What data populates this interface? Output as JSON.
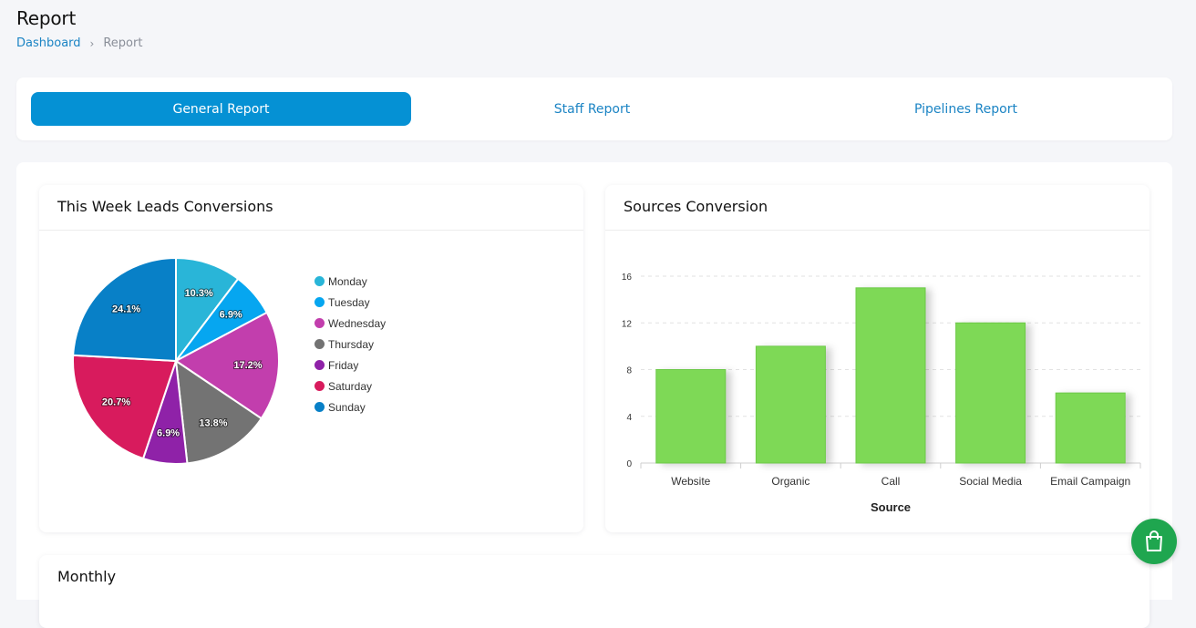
{
  "header": {
    "title": "Report",
    "breadcrumb": {
      "home": "Dashboard",
      "separator": "›",
      "current": "Report"
    }
  },
  "tabs": [
    {
      "label": "General Report",
      "active": true
    },
    {
      "label": "Staff Report",
      "active": false
    },
    {
      "label": "Pipelines Report",
      "active": false
    }
  ],
  "panels": {
    "leads": {
      "title": "This Week Leads Conversions"
    },
    "sources": {
      "title": "Sources Conversion"
    },
    "monthly": {
      "title": "Monthly"
    }
  },
  "fab": {
    "icon": "shopping-bag-icon",
    "color": "#1fa64f"
  },
  "chart_data": [
    {
      "type": "pie",
      "categories": [
        "Monday",
        "Tuesday",
        "Wednesday",
        "Thursday",
        "Friday",
        "Saturday",
        "Sunday"
      ],
      "values": [
        10.3,
        6.9,
        17.2,
        13.8,
        6.9,
        20.7,
        24.1
      ],
      "labels": [
        "10.3%",
        "6.9%",
        "17.2%",
        "13.8%",
        "6.9%",
        "20.7%",
        "24.1%"
      ],
      "colors": [
        "#29b5d8",
        "#06a6f0",
        "#c23ead",
        "#737373",
        "#8f22a8",
        "#d81b5d",
        "#0880c7"
      ],
      "legend_position": "right"
    },
    {
      "type": "bar",
      "categories": [
        "Website",
        "Organic",
        "Call",
        "Social Media",
        "Email Campaign"
      ],
      "values": [
        8,
        10,
        15,
        12,
        6
      ],
      "xlabel": "Source",
      "ylabel": "",
      "ylim": [
        0,
        16
      ],
      "yticks": [
        0,
        4,
        8,
        12,
        16
      ],
      "grid": true,
      "color": "#7ed957"
    }
  ]
}
